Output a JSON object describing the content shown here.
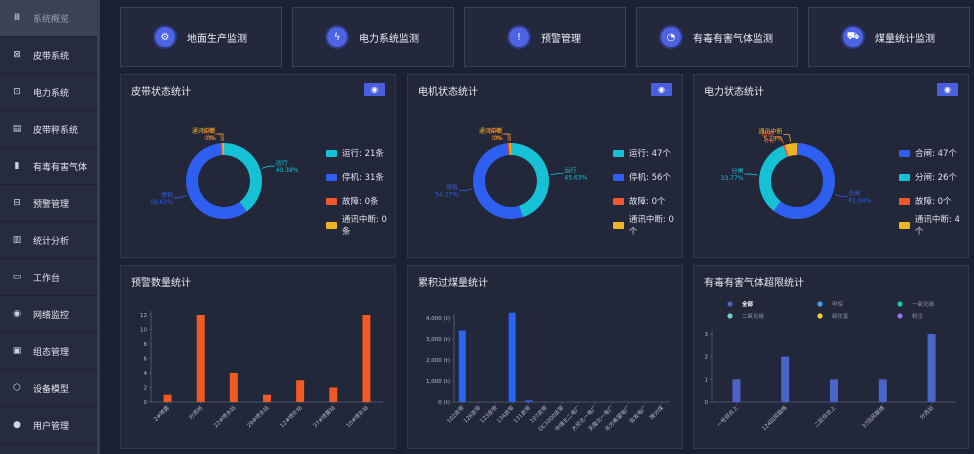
{
  "sidebar": {
    "items": [
      {
        "label": "系统概览",
        "icon": "grid-icon",
        "glyph": "Ⅲ"
      },
      {
        "label": "皮带系统",
        "icon": "belt-icon",
        "glyph": "⊠"
      },
      {
        "label": "电力系统",
        "icon": "power-icon",
        "glyph": "⊡"
      },
      {
        "label": "皮带秤系统",
        "icon": "scale-icon",
        "glyph": "▤"
      },
      {
        "label": "有毒有害气体",
        "icon": "gas-bottle-icon",
        "glyph": "▮"
      },
      {
        "label": "预警管理",
        "icon": "alert-icon",
        "glyph": "⊟"
      },
      {
        "label": "统计分析",
        "icon": "chart-icon",
        "glyph": "▥"
      },
      {
        "label": "工作台",
        "icon": "monitor-icon",
        "glyph": "▭"
      },
      {
        "label": "网络监控",
        "icon": "camera-icon",
        "glyph": "◉"
      },
      {
        "label": "组态管理",
        "icon": "config-icon",
        "glyph": "▣"
      },
      {
        "label": "设备模型",
        "icon": "cube-icon",
        "glyph": "⬡"
      },
      {
        "label": "用户管理",
        "icon": "user-icon",
        "glyph": "●"
      }
    ]
  },
  "topnav": [
    {
      "label": "地面生产监测",
      "icon": "ground-production-icon",
      "glyph": "⚙"
    },
    {
      "label": "电力系统监测",
      "icon": "lightning-icon",
      "glyph": "ϟ"
    },
    {
      "label": "预警管理",
      "icon": "warning-icon",
      "glyph": "!"
    },
    {
      "label": "有毒有害气体监测",
      "icon": "gauge-icon",
      "glyph": "◔"
    },
    {
      "label": "煤量统计监测",
      "icon": "cart-icon",
      "glyph": "⛟"
    }
  ],
  "colors": {
    "running": "#16c1d6",
    "stopped": "#2f5ff0",
    "fault": "#f05a2a",
    "comm": "#f0b323",
    "accent": "#4a5ee0"
  },
  "panels": {
    "belt": {
      "title": "皮带状态统计"
    },
    "motor": {
      "title": "电机状态统计"
    },
    "power": {
      "title": "电力状态统计"
    },
    "alerts": {
      "title": "预警数量统计"
    },
    "coal": {
      "title": "累积过煤量统计"
    },
    "gas": {
      "title": "有毒有害气体超限统计"
    }
  },
  "chart_data": [
    {
      "type": "pie",
      "id": "belt",
      "slices": [
        {
          "name": "运行",
          "value": 21,
          "pct": "40.38%",
          "color": "#16c1d6",
          "legend": "运行: 21条"
        },
        {
          "name": "停机",
          "value": 31,
          "pct": "59.62%",
          "color": "#2f5ff0",
          "legend": "停机: 31条"
        },
        {
          "name": "故障",
          "value": 0,
          "pct": "0%",
          "color": "#f05a2a",
          "legend": "故障: 0条"
        },
        {
          "name": "通讯中断",
          "value": 0,
          "pct": "0%",
          "color": "#f0b323",
          "legend": "通讯中断: 0条"
        }
      ]
    },
    {
      "type": "pie",
      "id": "motor",
      "slices": [
        {
          "name": "运行",
          "value": 47,
          "pct": "45.63%",
          "color": "#16c1d6",
          "legend": "运行: 47个"
        },
        {
          "name": "停机",
          "value": 56,
          "pct": "54.37%",
          "color": "#2f5ff0",
          "legend": "停机: 56个"
        },
        {
          "name": "故障",
          "value": 0,
          "pct": "0%",
          "color": "#f05a2a",
          "legend": "故障: 0个"
        },
        {
          "name": "通讯中断",
          "value": 0,
          "pct": "0%",
          "color": "#f0b323",
          "legend": "通讯中断: 0个"
        }
      ]
    },
    {
      "type": "pie",
      "id": "power",
      "slices": [
        {
          "name": "合闸",
          "value": 47,
          "pct": "61.04%",
          "color": "#2f5ff0",
          "legend": "合闸: 47个"
        },
        {
          "name": "分闸",
          "value": 26,
          "pct": "33.77%",
          "color": "#16c1d6",
          "legend": "分闸: 26个"
        },
        {
          "name": "故障",
          "value": 0,
          "pct": "0%",
          "color": "#f05a2a",
          "legend": "故障: 0个"
        },
        {
          "name": "通讯中断",
          "value": 4,
          "pct": "5.19%",
          "color": "#f0b323",
          "legend": "通讯中断: 4个"
        }
      ]
    },
    {
      "type": "bar",
      "id": "alerts",
      "categories": [
        "2#喷雾",
        "分选站",
        "22#喷水站",
        "29#喷水站",
        "12#喷补站",
        "37#喷雾站",
        "10#喷补站"
      ],
      "values": [
        1,
        12,
        4,
        1,
        3,
        2,
        12
      ],
      "ylim": [
        0,
        12
      ],
      "yticks": [
        0,
        2,
        4,
        6,
        8,
        10,
        12
      ],
      "color": "#f15a24"
    },
    {
      "type": "bar",
      "id": "coal",
      "categories": [
        "102皮带",
        "126皮带",
        "123皮带",
        "134皮带",
        "131皮带",
        "107皮带",
        "DC1000皮带",
        "中煤北二电厂",
        "大坝北一电厂",
        "天隆北一电厂",
        "东方希望电厂",
        "信发电厂",
        "陕分煤"
      ],
      "values": [
        3400,
        0,
        0,
        4250,
        80,
        0,
        0,
        0,
        0,
        0,
        0,
        0,
        0
      ],
      "ylim": [
        0,
        4000
      ],
      "yticks": [
        "0 (t)",
        "1,000 (t)",
        "2,000 (t)",
        "3,000 (t)",
        "4,000 (t)"
      ],
      "color": "#2b63f2"
    },
    {
      "type": "bar",
      "id": "gas",
      "categories": [
        "一号综合上",
        "124回风联络",
        "二区综合上",
        "37回风联络",
        "分选站"
      ],
      "values": [
        1,
        2,
        1,
        1,
        3
      ],
      "ylim": [
        0,
        3
      ],
      "yticks": [
        0,
        1,
        2,
        3
      ],
      "color": "#4a64c8",
      "legend": [
        {
          "name": "全部",
          "color": "#4a64c8"
        },
        {
          "name": "甲烷",
          "color": "#3fa0f5"
        },
        {
          "name": "一氧化碳",
          "color": "#2bc4a0"
        },
        {
          "name": "二氧化碳",
          "color": "#6fd0c0"
        },
        {
          "name": "硫化氢",
          "color": "#f0d040"
        },
        {
          "name": "粉尘",
          "color": "#9a6ee8"
        }
      ]
    }
  ]
}
